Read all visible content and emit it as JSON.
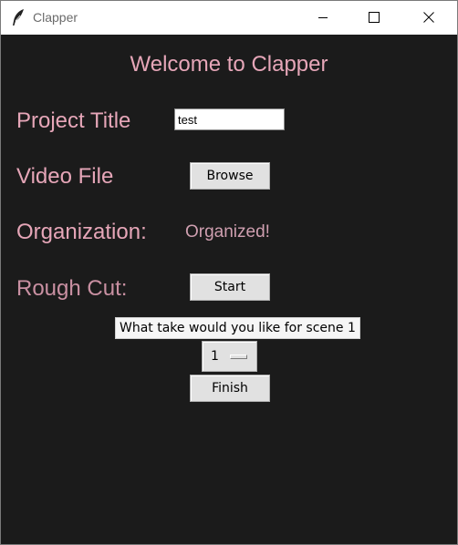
{
  "window": {
    "title": "Clapper",
    "icon": "feather-icon"
  },
  "main": {
    "heading": "Welcome to Clapper",
    "project_title": {
      "label": "Project Title",
      "value": "test"
    },
    "video_file": {
      "label": "Video File",
      "button_label": "Browse"
    },
    "organization": {
      "label": "Organization:",
      "status": "Organized!"
    },
    "rough_cut": {
      "label": "Rough Cut:",
      "button_label": "Start"
    },
    "take_prompt": "What take would you like for scene 1",
    "take_select": {
      "selected": "1"
    },
    "finish_label": "Finish"
  },
  "colors": {
    "background": "#1b1b1b",
    "label_pink": "#e6a6b8",
    "button_gray": "#e1e1e1"
  }
}
